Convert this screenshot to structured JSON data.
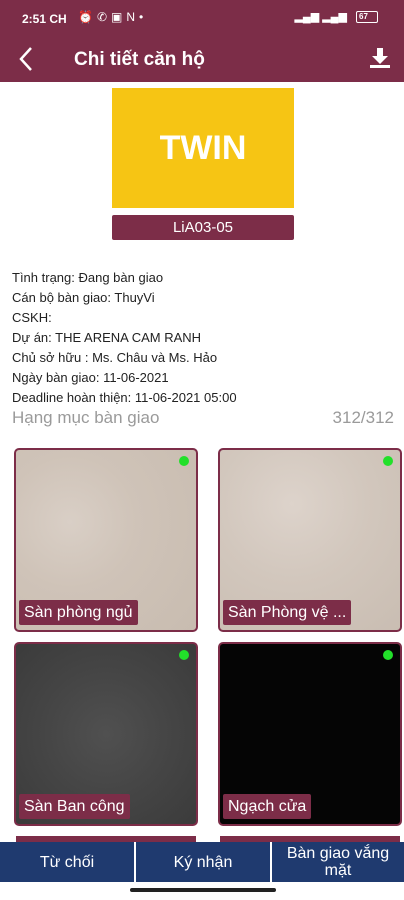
{
  "status_bar": {
    "time": "2:51 CH",
    "left_icons": [
      "alarm-icon",
      "wifi-calling-icon",
      "screen-icon",
      "n-icon",
      "dot-icon"
    ],
    "right_icons": [
      "signal-icon",
      "signal-icon-2"
    ],
    "battery": "67"
  },
  "header": {
    "title": "Chi tiết căn hộ",
    "back_icon": "back-arrow-icon",
    "download_icon": "download-icon"
  },
  "unit": {
    "image_text": "TWIN",
    "code": "LiA03-05"
  },
  "info": {
    "status": "Tình trạng: Đang bàn giao",
    "handover_staff": "Cán bộ bàn giao: ThuyVi",
    "cskh": "CSKH:",
    "project": "Dự án: THE ARENA CAM RANH",
    "owner": "Chủ sở hữu : Ms. Châu và Ms. Hảo",
    "handover_date": "Ngày bàn giao: 11-06-2021",
    "deadline": "Deadline hoàn thiện: 11-06-2021 05:00"
  },
  "section": {
    "title": "Hạng mục bàn giao",
    "count": "312/312"
  },
  "items": [
    {
      "label": "Sàn phòng ngủ",
      "status_color": "#22e02a"
    },
    {
      "label": "Sàn Phòng vệ  ...",
      "status_color": "#22e02a"
    },
    {
      "label": "Sàn Ban công",
      "status_color": "#22e02a"
    },
    {
      "label": "Ngạch cửa",
      "status_color": "#22e02a"
    }
  ],
  "actions": {
    "reject": "Từ chối",
    "sign": "Ký nhận",
    "absent": "Bàn giao vắng mặt"
  },
  "colors": {
    "primary": "#7c2d48",
    "action": "#1f3a6f",
    "accent_tile": "#f6c514",
    "done_dot": "#22e02a"
  }
}
